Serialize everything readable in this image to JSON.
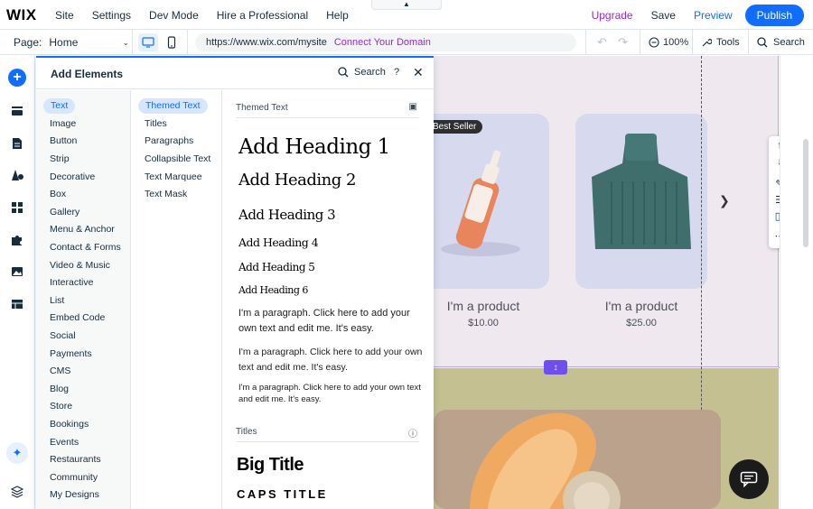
{
  "topbar": {
    "logo": "WIX",
    "menu": [
      "Site",
      "Settings",
      "Dev Mode",
      "Hire a Professional",
      "Help"
    ],
    "upgrade": "Upgrade",
    "save": "Save",
    "preview": "Preview",
    "publish": "Publish"
  },
  "secbar": {
    "page_label": "Page:",
    "page_value": "Home",
    "url": "https://www.wix.com/mysite",
    "connect": "Connect Your Domain",
    "zoom": "100%",
    "tools": "Tools",
    "search": "Search"
  },
  "panel": {
    "title": "Add Elements",
    "search": "Search",
    "help": "?",
    "categories": [
      "Text",
      "Image",
      "Button",
      "Strip",
      "Decorative",
      "Box",
      "Gallery",
      "Menu & Anchor",
      "Contact & Forms",
      "Video & Music",
      "Interactive",
      "List",
      "Embed Code",
      "Social",
      "Payments",
      "CMS",
      "Blog",
      "Store",
      "Bookings",
      "Events",
      "Restaurants",
      "Community",
      "My Designs"
    ],
    "subcategories": [
      "Themed Text",
      "Titles",
      "Paragraphs",
      "Collapsible Text",
      "Text Marquee",
      "Text Mask"
    ],
    "themed_text": {
      "header": "Themed Text",
      "headings": [
        "Add Heading 1",
        "Add Heading 2",
        "Add Heading 3",
        "Add Heading 4",
        "Add Heading 5",
        "Add Heading 6"
      ],
      "paragraphs": [
        "I'm a paragraph. Click here to add your own text and edit me. It's easy.",
        "I'm a paragraph. Click here to add your own text and edit me. It's easy.",
        "I'm a paragraph. Click here to add your own text and edit me. It's easy."
      ]
    },
    "titles": {
      "header": "Titles",
      "big_title": "Big Title",
      "caps_title": "CAPS TITLE"
    }
  },
  "canvas": {
    "badge": "Best Seller",
    "products": [
      {
        "name": "I'm a product",
        "price": "$10.00"
      },
      {
        "name": "I'm a product",
        "price": "$25.00"
      }
    ]
  },
  "colors": {
    "accent": "#116dff",
    "upgrade": "#9a27d5",
    "selected_bg": "#d6e6fe",
    "strip_bg": "#efe8ef",
    "card_bg": "#d7d9ef"
  }
}
